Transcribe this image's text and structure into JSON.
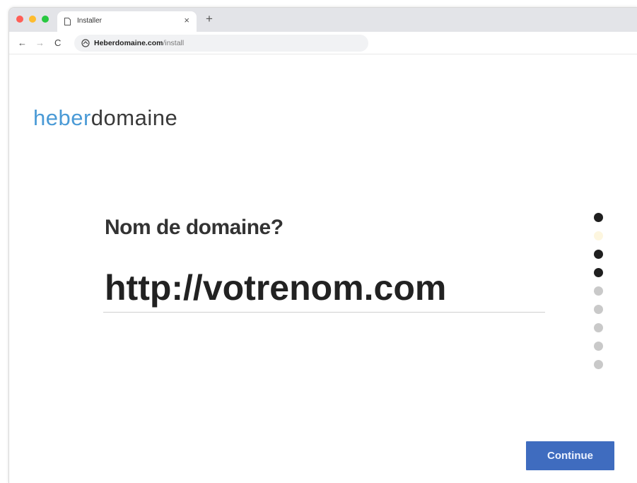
{
  "browser": {
    "tab_title": "Installer",
    "tab_close": "×",
    "new_tab": "+",
    "back": "←",
    "forward": "→",
    "reload": "C",
    "address_host": "Heberdomaine.com",
    "address_path": "/install"
  },
  "logo": {
    "part1": "heber",
    "part2": "domaine"
  },
  "form": {
    "question": "Nom de domaine?",
    "input_placeholder": "http://votrenom.com",
    "input_value": ""
  },
  "steps": [
    "done",
    "current",
    "done",
    "done",
    "todo",
    "todo",
    "todo",
    "todo",
    "todo"
  ],
  "actions": {
    "continue_label": "Continue"
  },
  "colors": {
    "accent": "#3f6cbf",
    "logo_blue": "#4a9ad6",
    "step_done": "#1f1f1f",
    "step_current": "#fdf6df",
    "step_todo": "#c9c9c9"
  }
}
